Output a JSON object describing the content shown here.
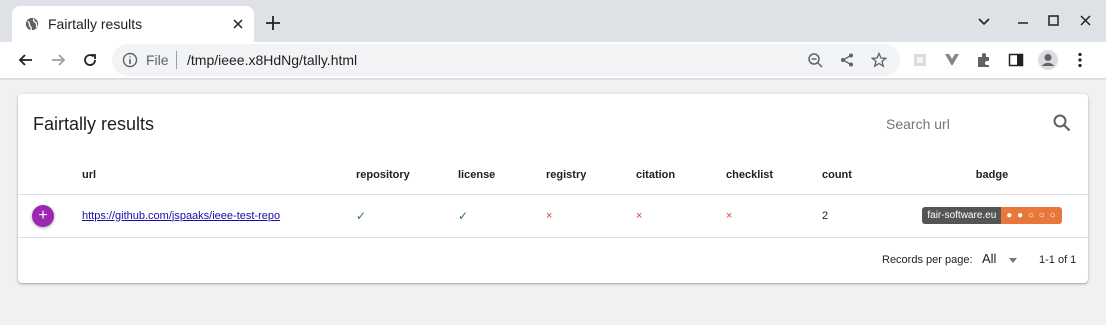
{
  "browser": {
    "tab_title": "Fairtally results",
    "scheme": "File",
    "url": "/tmp/ieee.x8HdNg/tally.html"
  },
  "card": {
    "title": "Fairtally results",
    "search_placeholder": "Search url"
  },
  "table": {
    "headers": {
      "url": "url",
      "repository": "repository",
      "license": "license",
      "registry": "registry",
      "citation": "citation",
      "checklist": "checklist",
      "count": "count",
      "badge": "badge"
    },
    "rows": [
      {
        "expand": "+",
        "url": "https://github.com/jspaaks/ieee-test-repo",
        "repository": "✓",
        "license": "✓",
        "registry": "×",
        "citation": "×",
        "checklist": "×",
        "count": "2",
        "badge_label": "fair-software.eu",
        "badge_value": "● ● ○ ○ ○"
      }
    ]
  },
  "footer": {
    "records_per_page_label": "Records per page:",
    "records_per_page_value": "All",
    "range": "1-1 of 1"
  },
  "colors": {
    "expand_button": "#9c27b0",
    "check": "#2e7d32",
    "cross": "#e53935",
    "badge_left": "#555555",
    "badge_right": "#e8773b"
  },
  "icons": {
    "tab": "globe-icon",
    "search": "search-icon"
  }
}
